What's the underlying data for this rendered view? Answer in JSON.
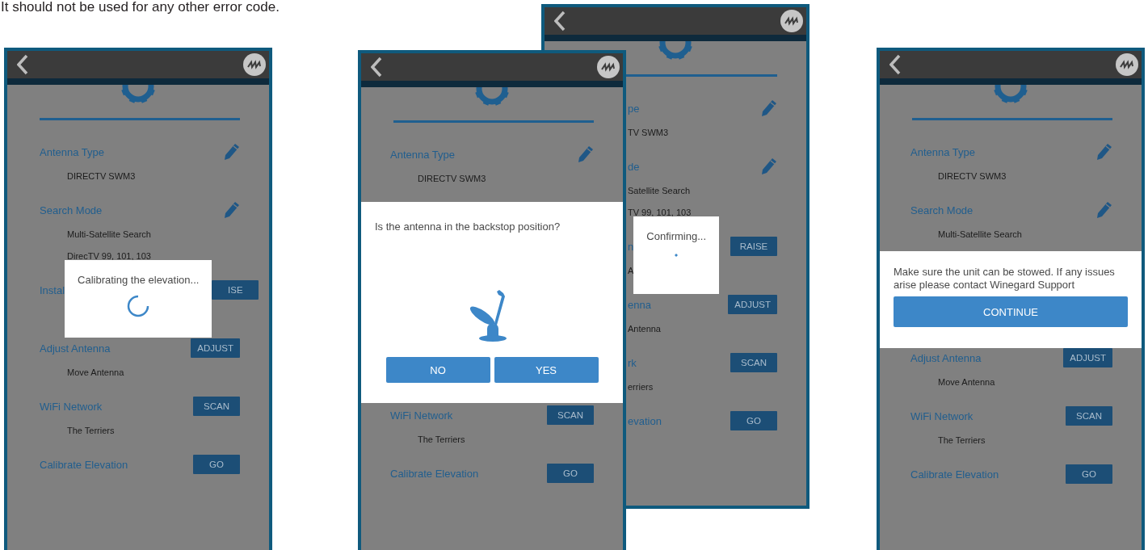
{
  "caption": "It should not be used for any other error code.",
  "phones": [
    {
      "items": [
        {
          "kind": "setting",
          "label": "Antenna Type",
          "values": [
            "DIRECTV SWM3"
          ],
          "action": {
            "kind": "edit"
          }
        },
        {
          "kind": "setting",
          "label": "Search Mode",
          "values": [
            "Multi-Satellite Search",
            "DirecTV 99, 101, 103"
          ],
          "action": {
            "kind": "edit"
          }
        },
        {
          "kind": "dialog_row",
          "label": "Instal",
          "action": {
            "kind": "button",
            "label": "ISE"
          },
          "dialog": {
            "kind": "progress_ring",
            "message": "Calibrating the elevation..."
          }
        },
        {
          "kind": "setting",
          "label": "Adjust Antenna",
          "values": [
            "Move Antenna"
          ],
          "action": {
            "kind": "button",
            "label": "ADJUST"
          }
        },
        {
          "kind": "setting",
          "label": "WiFi Network",
          "values": [
            "The Terriers"
          ],
          "action": {
            "kind": "button",
            "label": "SCAN"
          }
        },
        {
          "kind": "setting",
          "label": "Calibrate Elevation",
          "action": {
            "kind": "button",
            "label": "GO"
          }
        }
      ]
    },
    {
      "items": [
        {
          "kind": "setting",
          "label": "Antenna Type",
          "values": [
            "DIRECTV SWM3"
          ],
          "action": {
            "kind": "edit"
          }
        },
        {
          "kind": "dialog",
          "dialog": {
            "kind": "confirm",
            "message": "Is the antenna in the backstop position?",
            "buttons": [
              "NO",
              "YES"
            ]
          }
        },
        {
          "kind": "setting",
          "label": "WiFi Network",
          "values": [
            "The Terriers"
          ],
          "action": {
            "kind": "button",
            "label": "SCAN"
          }
        },
        {
          "kind": "setting",
          "label": "Calibrate Elevation",
          "action": {
            "kind": "button",
            "label": "GO"
          }
        }
      ]
    },
    {
      "items": [
        {
          "kind": "setting",
          "label": "pe",
          "values": [
            "TV SWM3"
          ],
          "action": {
            "kind": "edit"
          }
        },
        {
          "kind": "setting",
          "label": "de",
          "values": [
            "Satellite Search",
            "TV 99, 101, 103"
          ],
          "action": {
            "kind": "edit"
          }
        },
        {
          "kind": "dialog_row",
          "label": "n",
          "values": [
            "A"
          ],
          "action": {
            "kind": "button",
            "label": "RAISE"
          },
          "dialog": {
            "kind": "progress_dot",
            "message": "Confirming..."
          }
        },
        {
          "kind": "setting",
          "label": "enna",
          "values": [
            "Antenna"
          ],
          "action": {
            "kind": "button",
            "label": "ADJUST"
          }
        },
        {
          "kind": "setting",
          "label": "rk",
          "values": [
            "erriers"
          ],
          "action": {
            "kind": "button",
            "label": "SCAN"
          }
        },
        {
          "kind": "setting",
          "label": "evation",
          "action": {
            "kind": "button",
            "label": "GO"
          }
        }
      ]
    },
    {
      "items": [
        {
          "kind": "setting",
          "label": "Antenna Type",
          "values": [
            "DIRECTV SWM3"
          ],
          "action": {
            "kind": "edit"
          }
        },
        {
          "kind": "setting",
          "label": "Search Mode",
          "values": [
            "Multi-Satellite Search"
          ],
          "action": {
            "kind": "edit"
          }
        },
        {
          "kind": "dialog",
          "dialog": {
            "kind": "notice",
            "message": "Make sure the unit can be stowed. If any issues arise please contact Winegard Support",
            "buttons": [
              "CONTINUE"
            ]
          }
        },
        {
          "kind": "setting",
          "label": "Adjust Antenna",
          "values": [
            "Move Antenna"
          ],
          "action": {
            "kind": "button",
            "label": "ADJUST"
          }
        },
        {
          "kind": "setting",
          "label": "WiFi Network",
          "values": [
            "The Terriers"
          ],
          "action": {
            "kind": "button",
            "label": "SCAN"
          }
        },
        {
          "kind": "setting",
          "label": "Calibrate Elevation",
          "action": {
            "kind": "button",
            "label": "GO"
          }
        }
      ]
    }
  ]
}
